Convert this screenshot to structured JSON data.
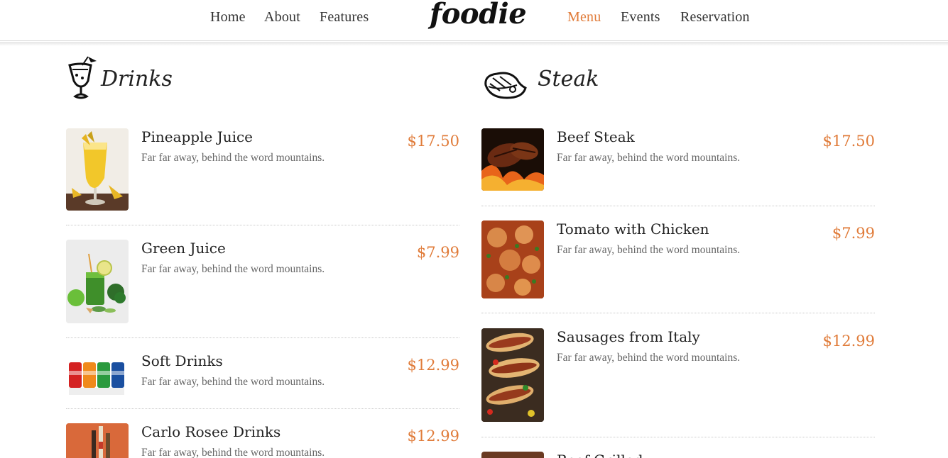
{
  "nav": {
    "left_links": [
      "Home",
      "About",
      "Features"
    ],
    "brand": "foodie",
    "right_links": [
      "Menu",
      "Events",
      "Reservation"
    ],
    "active": "Menu",
    "accent_color": "#e07b39"
  },
  "drinks": {
    "title": "Drinks",
    "icon": "cocktail-glass-icon",
    "items": [
      {
        "name": "Pineapple Juice",
        "desc": "Far far away, behind the word mountains.",
        "price": "$17.50"
      },
      {
        "name": "Green Juice",
        "desc": "Far far away, behind the word mountains.",
        "price": "$7.99"
      },
      {
        "name": "Soft Drinks",
        "desc": "Far far away, behind the word mountains.",
        "price": "$12.99"
      },
      {
        "name": "Carlo Rosee Drinks",
        "desc": "Far far away, behind the word mountains.",
        "price": "$12.99"
      }
    ]
  },
  "steak": {
    "title": "Steak",
    "icon": "steak-icon",
    "items": [
      {
        "name": "Beef Steak",
        "desc": "Far far away, behind the word mountains.",
        "price": "$17.50"
      },
      {
        "name": "Tomato with Chicken",
        "desc": "Far far away, behind the word mountains.",
        "price": "$7.99"
      },
      {
        "name": "Sausages from Italy",
        "desc": "Far far away, behind the word mountains.",
        "price": "$12.99"
      },
      {
        "name": "Beef Grilled",
        "desc": "",
        "price": ""
      }
    ]
  }
}
